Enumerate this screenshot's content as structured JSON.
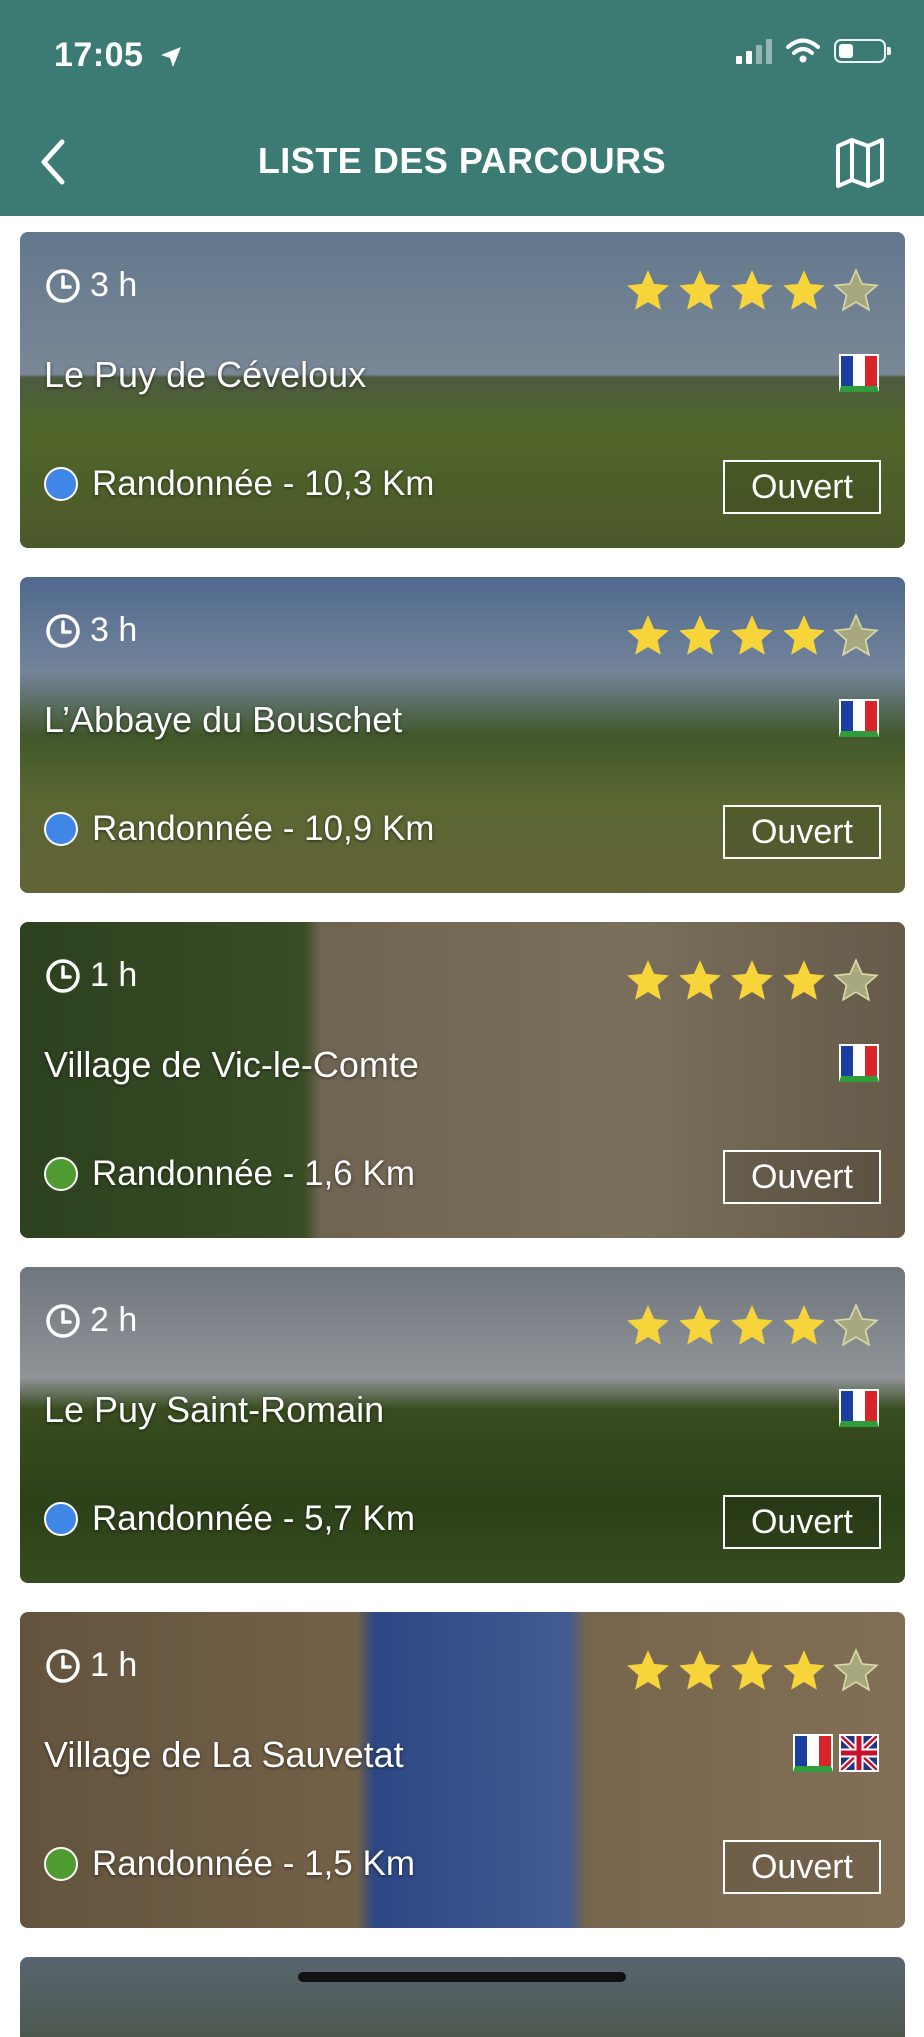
{
  "status_bar": {
    "time": "17:05"
  },
  "nav": {
    "title": "LISTE DES PARCOURS"
  },
  "routes": [
    {
      "duration": "3 h",
      "name": "Le Puy de Céveloux",
      "type_label": "Randonnée - 10,3 Km",
      "status": "Ouvert",
      "rating": 4,
      "max_rating": 5,
      "difficulty_color": "#3f86e6",
      "languages": [
        "fr"
      ]
    },
    {
      "duration": "3 h",
      "name": "L’Abbaye du Bouschet",
      "type_label": "Randonnée - 10,9 Km",
      "status": "Ouvert",
      "rating": 4,
      "max_rating": 5,
      "difficulty_color": "#3f86e6",
      "languages": [
        "fr"
      ]
    },
    {
      "duration": "1 h",
      "name": "Village de Vic-le-Comte",
      "type_label": "Randonnée - 1,6 Km",
      "status": "Ouvert",
      "rating": 4,
      "max_rating": 5,
      "difficulty_color": "#4f9a31",
      "languages": [
        "fr"
      ]
    },
    {
      "duration": "2 h",
      "name": "Le Puy Saint-Romain",
      "type_label": "Randonnée - 5,7 Km",
      "status": "Ouvert",
      "rating": 4,
      "max_rating": 5,
      "difficulty_color": "#3f86e6",
      "languages": [
        "fr"
      ]
    },
    {
      "duration": "1 h",
      "name": "Village de La Sauvetat",
      "type_label": "Randonnée - 1,5 Km",
      "status": "Ouvert",
      "rating": 4,
      "max_rating": 5,
      "difficulty_color": "#4f9a31",
      "languages": [
        "fr",
        "en"
      ]
    }
  ],
  "colors": {
    "header": "#3c7b74",
    "star_filled": "#f6d43a",
    "star_empty": "#a7a87d"
  }
}
